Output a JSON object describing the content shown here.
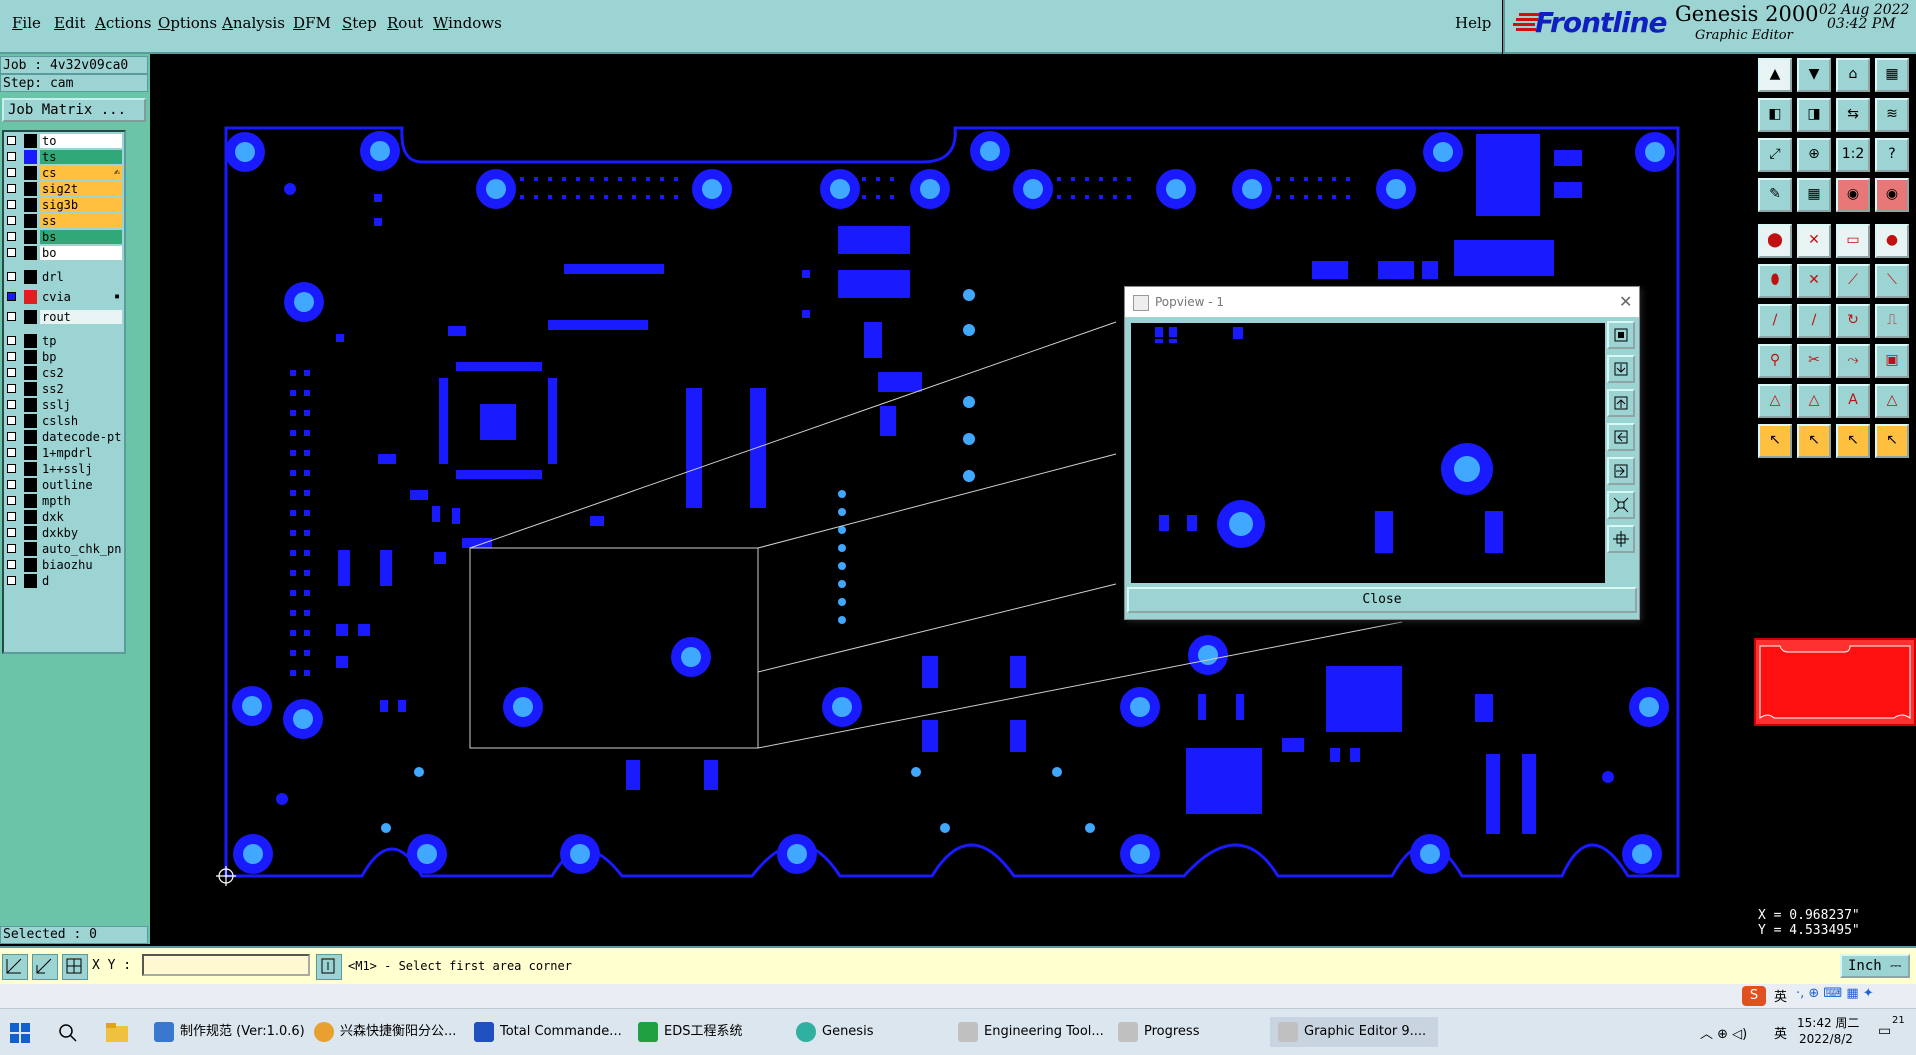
{
  "menu": {
    "items": [
      {
        "label": "File",
        "u": "F",
        "rest": "ile"
      },
      {
        "label": "Edit",
        "u": "E",
        "rest": "dit"
      },
      {
        "label": "Actions",
        "u": "A",
        "rest": "ctions"
      },
      {
        "label": "Options",
        "u": "O",
        "rest": "ptions"
      },
      {
        "label": "Analysis",
        "u": "A",
        "rest": "nalysis"
      },
      {
        "label": "DFM",
        "u": "D",
        "rest": "FM"
      },
      {
        "label": "Step",
        "u": "S",
        "rest": "tep"
      },
      {
        "label": "Rout",
        "u": "R",
        "rest": "out"
      },
      {
        "label": "Windows",
        "u": "W",
        "rest": "indows"
      }
    ],
    "help": "Help"
  },
  "brand": {
    "logo": "Frontline",
    "product": "Genesis 2000",
    "subtitle": "Graphic Editor",
    "date": "02 Aug 2022",
    "time": "03:42 PM",
    "accent": "#d01010"
  },
  "job": {
    "job_line": "Job : 4v32v09ca0",
    "step_line": "Step: cam",
    "matrix_label": "Job Matrix ..."
  },
  "layers": [
    {
      "name": "to",
      "color": "#ffffff",
      "swatch": "#000000"
    },
    {
      "name": "ts",
      "color": "#30a878",
      "swatch": "#1a1aff"
    },
    {
      "name": "cs",
      "color": "#ffc040",
      "swatch": "#000000",
      "marker": "✍"
    },
    {
      "name": "sig2t",
      "color": "#ffc040",
      "swatch": "#000000"
    },
    {
      "name": "sig3b",
      "color": "#ffc040",
      "swatch": "#000000"
    },
    {
      "name": "ss",
      "color": "#ffc040",
      "swatch": "#000000"
    },
    {
      "name": "bs",
      "color": "#30a878",
      "swatch": "#000000"
    },
    {
      "name": "bo",
      "color": "#ffffff",
      "swatch": "#000000"
    },
    {
      "name": "drl",
      "color": "#9cd4d4",
      "swatch": "#000000"
    },
    {
      "name": "cvia",
      "color": "#9cd4d4",
      "swatch": "#e02020",
      "chk": "#1a1aff",
      "marker": "▪"
    },
    {
      "name": "rout",
      "color": "#e8f4f4",
      "swatch": "#000000"
    },
    {
      "name": "tp",
      "color": "#9cd4d4",
      "swatch": "#000000"
    },
    {
      "name": "bp",
      "color": "#9cd4d4",
      "swatch": "#000000"
    },
    {
      "name": "cs2",
      "color": "#9cd4d4",
      "swatch": "#000000"
    },
    {
      "name": "ss2",
      "color": "#9cd4d4",
      "swatch": "#000000"
    },
    {
      "name": "sslj",
      "color": "#9cd4d4",
      "swatch": "#000000"
    },
    {
      "name": "cslsh",
      "color": "#9cd4d4",
      "swatch": "#000000"
    },
    {
      "name": "datecode-pt",
      "color": "#9cd4d4",
      "swatch": "#000000"
    },
    {
      "name": "1+mpdrl",
      "color": "#9cd4d4",
      "swatch": "#000000"
    },
    {
      "name": "1++sslj",
      "color": "#9cd4d4",
      "swatch": "#000000"
    },
    {
      "name": "outline",
      "color": "#9cd4d4",
      "swatch": "#000000"
    },
    {
      "name": "mpth",
      "color": "#9cd4d4",
      "swatch": "#000000"
    },
    {
      "name": "dxk",
      "color": "#9cd4d4",
      "swatch": "#000000"
    },
    {
      "name": "dxkby",
      "color": "#9cd4d4",
      "swatch": "#000000"
    },
    {
      "name": "auto_chk_pn",
      "color": "#9cd4d4",
      "swatch": "#000000"
    },
    {
      "name": "biaozhu",
      "color": "#9cd4d4",
      "swatch": "#000000"
    },
    {
      "name": "d",
      "color": "#9cd4d4",
      "swatch": "#000000"
    }
  ],
  "selected": "Selected : 0",
  "coords": {
    "x": "X = 0.968237\"",
    "y": "Y = 4.533495\""
  },
  "prompt": {
    "xy_label": "X Y :",
    "xy_value": "",
    "message": "<M1> - Select first area corner",
    "unit": "Inch"
  },
  "popview": {
    "title": "Popview - 1",
    "close_label": "Close"
  },
  "taskbar": {
    "items": [
      {
        "label": "制作规范 (Ver:1.0.6)",
        "icon": "document-icon",
        "color": "#3a78d0"
      },
      {
        "label": "兴森快捷衡阳分公...",
        "icon": "browser-icon",
        "color": "#e8a030"
      },
      {
        "label": "Total Commande...",
        "icon": "floppy-icon",
        "color": "#2050c0"
      },
      {
        "label": "EDS工程系统",
        "icon": "eds-icon",
        "color": "#20a040"
      },
      {
        "label": "Genesis",
        "icon": "genesis-icon",
        "color": "#30b0a0"
      },
      {
        "label": "Engineering Tool...",
        "icon": "x-window-icon",
        "color": "#c0c0c0"
      },
      {
        "label": "Progress",
        "icon": "x-window-icon",
        "color": "#c0c0c0"
      },
      {
        "label": "Graphic Editor 9....",
        "icon": "x-window-icon",
        "color": "#c0c0c0"
      }
    ],
    "ime": "英",
    "tray_ime": "英",
    "clock_time": "15:42 周二",
    "clock_date": "2022/8/2",
    "notify_count": "21"
  },
  "colors": {
    "board_blue": "#1a1aff",
    "pad_fill": "#40a8ff",
    "panel_teal": "#9cd4d4",
    "highlight_red": "#ff1010"
  }
}
